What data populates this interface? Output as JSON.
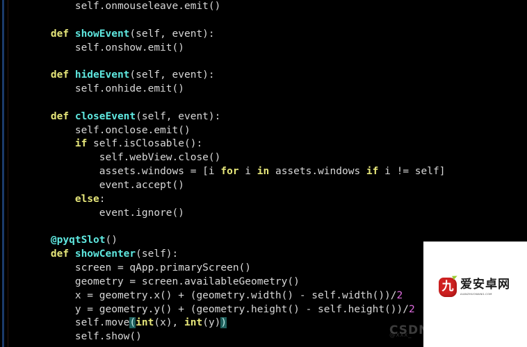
{
  "editor": {
    "language": "python",
    "background": "#000000",
    "default_text_color": "#d8d8d8",
    "colors": {
      "keyword": "#e6e67a",
      "function": "#5fe8e0",
      "decorator": "#5fe8e0",
      "number": "#e06ce0",
      "bracket_match_bg": "#1f5f5c",
      "edge_blue": "#1b3a6b",
      "edge_red": "#2a1410"
    },
    "lines": [
      {
        "n": 1,
        "indent": 8,
        "tokens": [
          {
            "t": "self.onmouseleave.emit()",
            "c": "plain"
          }
        ]
      },
      {
        "n": 2,
        "indent": 0,
        "tokens": []
      },
      {
        "n": 3,
        "indent": 4,
        "tokens": [
          {
            "t": "def ",
            "c": "kw"
          },
          {
            "t": "showEvent",
            "c": "fn"
          },
          {
            "t": "(self, event):",
            "c": "plain"
          }
        ]
      },
      {
        "n": 4,
        "indent": 8,
        "tokens": [
          {
            "t": "self.onshow.emit()",
            "c": "plain"
          }
        ]
      },
      {
        "n": 5,
        "indent": 0,
        "tokens": []
      },
      {
        "n": 6,
        "indent": 4,
        "tokens": [
          {
            "t": "def ",
            "c": "kw"
          },
          {
            "t": "hideEvent",
            "c": "fn"
          },
          {
            "t": "(self, event):",
            "c": "plain"
          }
        ]
      },
      {
        "n": 7,
        "indent": 8,
        "tokens": [
          {
            "t": "self.onhide.emit()",
            "c": "plain"
          }
        ]
      },
      {
        "n": 8,
        "indent": 0,
        "tokens": []
      },
      {
        "n": 9,
        "indent": 4,
        "tokens": [
          {
            "t": "def ",
            "c": "kw"
          },
          {
            "t": "closeEvent",
            "c": "fn"
          },
          {
            "t": "(self, event):",
            "c": "plain"
          }
        ]
      },
      {
        "n": 10,
        "indent": 8,
        "tokens": [
          {
            "t": "self.onclose.emit()",
            "c": "plain"
          }
        ]
      },
      {
        "n": 11,
        "indent": 8,
        "tokens": [
          {
            "t": "if ",
            "c": "kw"
          },
          {
            "t": "self.isClosable():",
            "c": "plain"
          }
        ]
      },
      {
        "n": 12,
        "indent": 12,
        "tokens": [
          {
            "t": "self.webView.close()",
            "c": "plain"
          }
        ]
      },
      {
        "n": 13,
        "indent": 12,
        "tokens": [
          {
            "t": "assets.windows = [i ",
            "c": "plain"
          },
          {
            "t": "for ",
            "c": "kw"
          },
          {
            "t": "i ",
            "c": "plain"
          },
          {
            "t": "in ",
            "c": "kw"
          },
          {
            "t": "assets.windows ",
            "c": "plain"
          },
          {
            "t": "if ",
            "c": "kw"
          },
          {
            "t": "i != self]",
            "c": "plain"
          }
        ]
      },
      {
        "n": 14,
        "indent": 12,
        "tokens": [
          {
            "t": "event.accept()",
            "c": "plain"
          }
        ]
      },
      {
        "n": 15,
        "indent": 8,
        "tokens": [
          {
            "t": "else",
            "c": "kw"
          },
          {
            "t": ":",
            "c": "plain"
          }
        ]
      },
      {
        "n": 16,
        "indent": 12,
        "tokens": [
          {
            "t": "event.ignore()",
            "c": "plain"
          }
        ]
      },
      {
        "n": 17,
        "indent": 0,
        "tokens": []
      },
      {
        "n": 18,
        "indent": 4,
        "tokens": [
          {
            "t": "@pyqtSlot",
            "c": "deco"
          },
          {
            "t": "()",
            "c": "plain"
          }
        ]
      },
      {
        "n": 19,
        "indent": 4,
        "tokens": [
          {
            "t": "def ",
            "c": "kw"
          },
          {
            "t": "showCenter",
            "c": "fn"
          },
          {
            "t": "(self):",
            "c": "plain"
          }
        ]
      },
      {
        "n": 20,
        "indent": 8,
        "tokens": [
          {
            "t": "screen = qApp.primaryScreen()",
            "c": "plain"
          }
        ]
      },
      {
        "n": 21,
        "indent": 8,
        "tokens": [
          {
            "t": "geometry = screen.availableGeometry()",
            "c": "plain"
          }
        ]
      },
      {
        "n": 22,
        "indent": 8,
        "tokens": [
          {
            "t": "x = geometry.x() + (geometry.width() - self.width())/",
            "c": "plain"
          },
          {
            "t": "2",
            "c": "num"
          }
        ]
      },
      {
        "n": 23,
        "indent": 8,
        "tokens": [
          {
            "t": "y = geometry.y() + (geometry.height() - self.height())/",
            "c": "plain"
          },
          {
            "t": "2",
            "c": "num"
          }
        ]
      },
      {
        "n": 24,
        "indent": 8,
        "tokens": [
          {
            "t": "self.move",
            "c": "plain"
          },
          {
            "t": "(",
            "c": "brk-hl"
          },
          {
            "t": "int",
            "c": "kw"
          },
          {
            "t": "(x), ",
            "c": "plain"
          },
          {
            "t": "int",
            "c": "kw"
          },
          {
            "t": "(y)",
            "c": "plain"
          },
          {
            "t": ")",
            "c": "brk-hl"
          }
        ]
      },
      {
        "n": 25,
        "indent": 8,
        "tokens": [
          {
            "t": "self.show()",
            "c": "plain"
          }
        ]
      }
    ]
  },
  "overlay": {
    "logo": {
      "badge_glyph": "九",
      "badge_color": "#cf2222",
      "brand_cn": "爱安卓网",
      "brand_en": "AIANZHUOWANG.COM"
    }
  },
  "watermark": {
    "text": "CSDN",
    "subtext": "@xxx_"
  }
}
